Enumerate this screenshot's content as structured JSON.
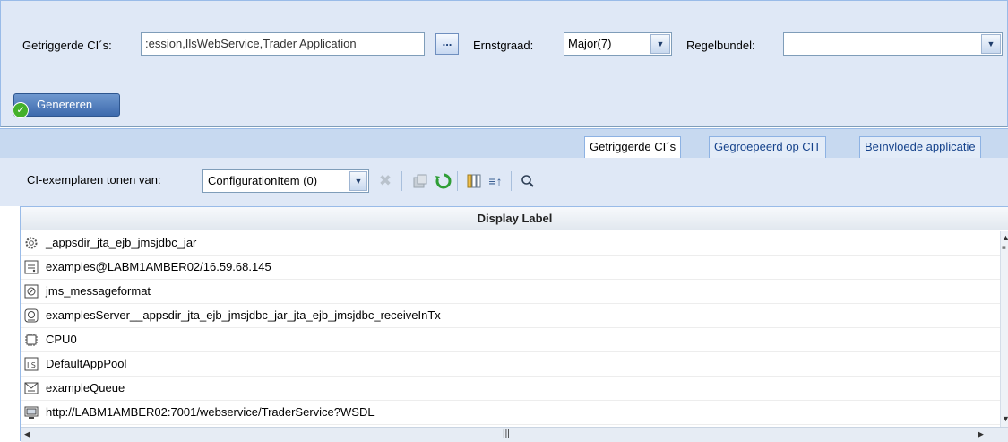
{
  "form": {
    "triggered_cis_label": "Getriggerde CI´s:",
    "triggered_cis_value": ":ession,IlsWebService,Trader Application",
    "browse_button_label": "...",
    "severity_label": "Ernstgraad:",
    "severity_value": "Major(7)",
    "rulebundle_label": "Regelbundel:",
    "rulebundle_value": "",
    "generate_button_label": "Genereren"
  },
  "tabs": [
    {
      "label": "Getriggerde CI´s",
      "active": true
    },
    {
      "label": "Gegroepeerd op CIT",
      "active": false
    },
    {
      "label": "Beïnvloede applicatie",
      "active": false
    }
  ],
  "toolbar": {
    "show_instances_label": "CI-exemplaren tonen van:",
    "show_instances_value": "ConfigurationItem (0)",
    "icons": [
      "delete-icon",
      "properties-icon",
      "refresh-icon",
      "columns-icon",
      "sort-icon",
      "search-icon"
    ]
  },
  "grid": {
    "column_header": "Display Label",
    "rows": [
      {
        "icon": "gear-icon",
        "label": "_appsdir_jta_ejb_jmsjdbc_jar"
      },
      {
        "icon": "server-icon",
        "label": "examples@LABM1AMBER02/16.59.68.145"
      },
      {
        "icon": "module-icon",
        "label": "jms_messageformat"
      },
      {
        "icon": "ejb-icon",
        "label": "examplesServer__appsdir_jta_ejb_jmsjdbc_jar_jta_ejb_jmsjdbc_receiveInTx"
      },
      {
        "icon": "cpu-icon",
        "label": "CPU0"
      },
      {
        "icon": "iis-icon",
        "label": "DefaultAppPool"
      },
      {
        "icon": "queue-icon",
        "label": "exampleQueue"
      },
      {
        "icon": "webservice-icon",
        "label": "http://LABM1AMBER02:7001/webservice/TraderService?WSDL"
      }
    ],
    "hscroll_grip": "|||"
  },
  "colors": {
    "panel_bg": "#dfe8f6",
    "border": "#99bbe8",
    "button_blue": "#3d6aad",
    "check_green": "#43b02a"
  }
}
